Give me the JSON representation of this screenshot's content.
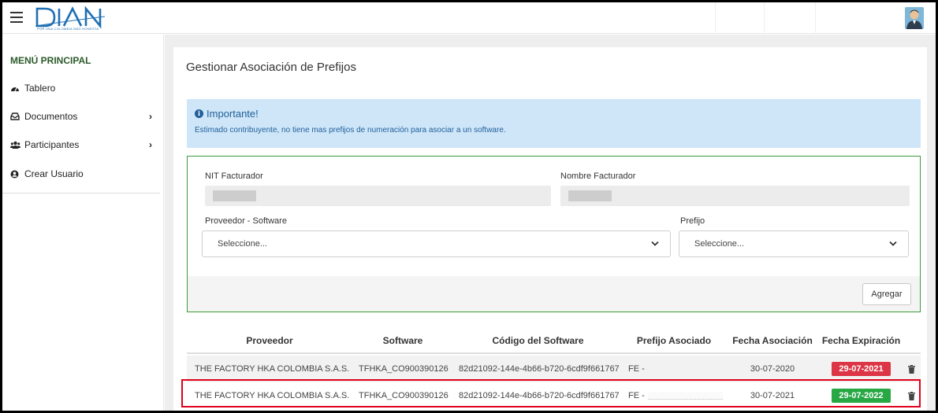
{
  "header": {
    "logo_text": "DIAN",
    "logo_tagline": "POR UNA COLOMBIA MÁS HONESTA"
  },
  "sidebar": {
    "title": "MENÚ PRINCIPAL",
    "items": [
      {
        "label": "Tablero",
        "icon": "dashboard-icon"
      },
      {
        "label": "Documentos",
        "icon": "inbox-icon"
      },
      {
        "label": "Participantes",
        "icon": "users-icon"
      },
      {
        "label": "Crear Usuario",
        "icon": "user-circle-icon"
      }
    ]
  },
  "main": {
    "page_title": "Gestionar Asociación de Prefijos",
    "alert": {
      "title": "Importante!",
      "text": "Estimado contribuyente, no tiene mas prefijos de numeración para asociar a un software."
    },
    "form": {
      "nit_label": "NIT Facturador",
      "nombre_label": "Nombre Facturador",
      "proveedor_label": "Proveedor - Software",
      "proveedor_value": "Seleccione...",
      "prefijo_label": "Prefijo",
      "prefijo_value": "Seleccione...",
      "add_button": "Agregar"
    },
    "table": {
      "columns": [
        "Proveedor",
        "Software",
        "Código del Software",
        "Prefijo Asociado",
        "Fecha Asociación",
        "Fecha Expiración"
      ],
      "rows": [
        {
          "proveedor": "THE FACTORY HKA COLOMBIA S.A.S.",
          "software": "TFHKA_CO900390126",
          "codigo": "82d21092-144e-4b66-b720-6cdf9f661767",
          "prefijo": "FE -",
          "fecha_asociacion": "30-07-2020",
          "fecha_expiracion": "29-07-2021",
          "status_color": "#dc3545"
        },
        {
          "proveedor": "THE FACTORY HKA COLOMBIA S.A.S.",
          "software": "TFHKA_CO900390126",
          "codigo": "82d21092-144e-4b66-b720-6cdf9f661767",
          "prefijo": "FE -",
          "fecha_asociacion": "30-07-2021",
          "fecha_expiracion": "29-07-2022",
          "status_color": "#28a745"
        }
      ]
    }
  },
  "colors": {
    "brand": "#1f6fb2",
    "alert_bg": "#cfe6f8",
    "form_border": "#3a9c3a",
    "highlight": "#e0001a"
  }
}
